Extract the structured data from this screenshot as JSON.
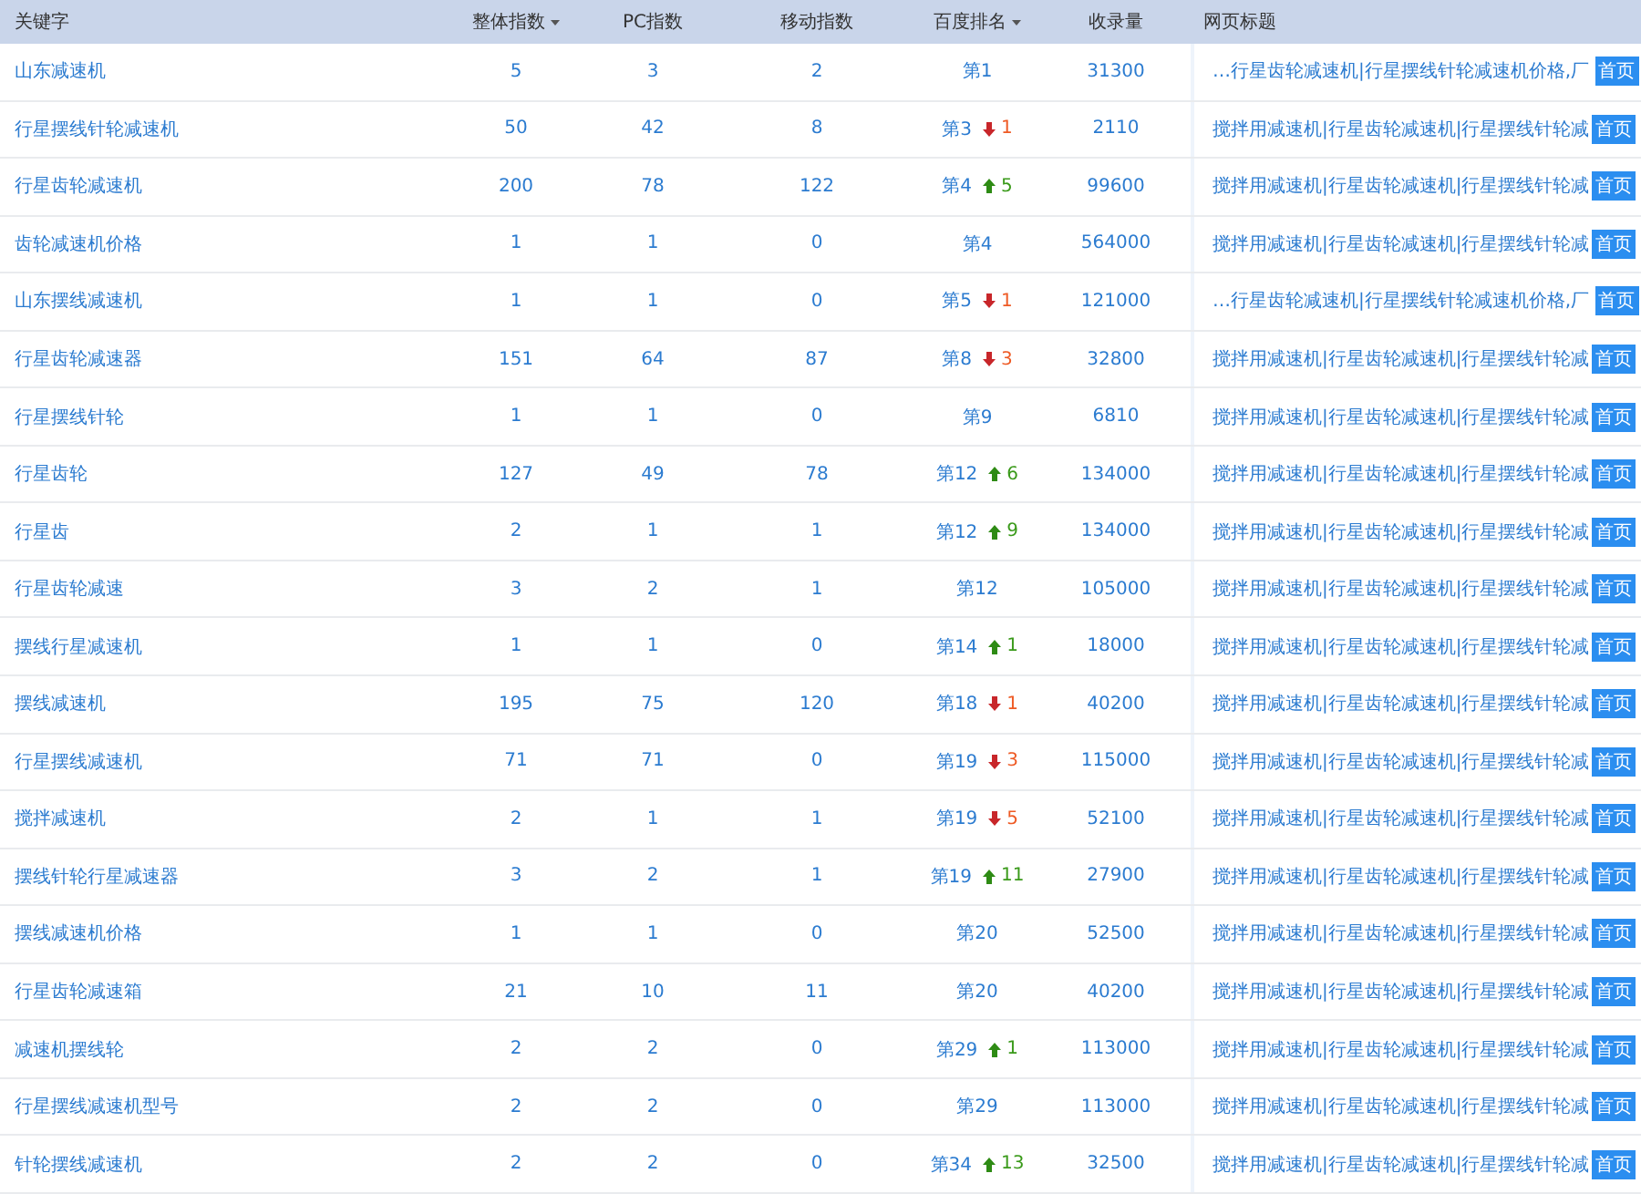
{
  "table": {
    "columns": [
      {
        "label": "关键字",
        "sorted": false
      },
      {
        "label": "整体指数",
        "sorted": true
      },
      {
        "label": "PC指数",
        "sorted": false
      },
      {
        "label": "移动指数",
        "sorted": false
      },
      {
        "label": "百度排名",
        "sorted": true
      },
      {
        "label": "收录量",
        "sorted": false
      },
      {
        "label": "网页标题",
        "sorted": false
      }
    ],
    "rows": [
      {
        "keyword": "山东减速机",
        "overall": "5",
        "pc": "3",
        "mobile": "2",
        "rank": "第1",
        "indexed": "31300",
        "title": "…行星齿轮减速机|行星摆线针轮减速机价格,厂",
        "badge": "首页"
      },
      {
        "keyword": "行星摆线针轮减速机",
        "overall": "50",
        "pc": "42",
        "mobile": "8",
        "rank": "第3",
        "change": {
          "kind": "down",
          "amount": "1"
        },
        "indexed": "2110",
        "title": "搅拌用减速机|行星齿轮减速机|行星摆线针轮减",
        "badge": "首页"
      },
      {
        "keyword": "行星齿轮减速机",
        "overall": "200",
        "pc": "78",
        "mobile": "122",
        "rank": "第4",
        "change": {
          "kind": "up",
          "amount": "5"
        },
        "indexed": "99600",
        "title": "搅拌用减速机|行星齿轮减速机|行星摆线针轮减",
        "badge": "首页"
      },
      {
        "keyword": "齿轮减速机价格",
        "overall": "1",
        "pc": "1",
        "mobile": "0",
        "rank": "第4",
        "indexed": "564000",
        "title": "搅拌用减速机|行星齿轮减速机|行星摆线针轮减",
        "badge": "首页"
      },
      {
        "keyword": "山东摆线减速机",
        "overall": "1",
        "pc": "1",
        "mobile": "0",
        "rank": "第5",
        "change": {
          "kind": "down",
          "amount": "1"
        },
        "indexed": "121000",
        "title": "…行星齿轮减速机|行星摆线针轮减速机价格,厂",
        "badge": "首页"
      },
      {
        "keyword": "行星齿轮减速器",
        "overall": "151",
        "pc": "64",
        "mobile": "87",
        "rank": "第8",
        "change": {
          "kind": "down",
          "amount": "3"
        },
        "indexed": "32800",
        "title": "搅拌用减速机|行星齿轮减速机|行星摆线针轮减",
        "badge": "首页"
      },
      {
        "keyword": "行星摆线针轮",
        "overall": "1",
        "pc": "1",
        "mobile": "0",
        "rank": "第9",
        "indexed": "6810",
        "title": "搅拌用减速机|行星齿轮减速机|行星摆线针轮减",
        "badge": "首页"
      },
      {
        "keyword": "行星齿轮",
        "overall": "127",
        "pc": "49",
        "mobile": "78",
        "rank": "第12",
        "change": {
          "kind": "up",
          "amount": "6"
        },
        "indexed": "134000",
        "title": "搅拌用减速机|行星齿轮减速机|行星摆线针轮减",
        "badge": "首页"
      },
      {
        "keyword": "行星齿",
        "overall": "2",
        "pc": "1",
        "mobile": "1",
        "rank": "第12",
        "change": {
          "kind": "up",
          "amount": "9"
        },
        "indexed": "134000",
        "title": "搅拌用减速机|行星齿轮减速机|行星摆线针轮减",
        "badge": "首页"
      },
      {
        "keyword": "行星齿轮减速",
        "overall": "3",
        "pc": "2",
        "mobile": "1",
        "rank": "第12",
        "indexed": "105000",
        "title": "搅拌用减速机|行星齿轮减速机|行星摆线针轮减",
        "badge": "首页"
      },
      {
        "keyword": "摆线行星减速机",
        "overall": "1",
        "pc": "1",
        "mobile": "0",
        "rank": "第14",
        "change": {
          "kind": "up",
          "amount": "1"
        },
        "indexed": "18000",
        "title": "搅拌用减速机|行星齿轮减速机|行星摆线针轮减",
        "badge": "首页"
      },
      {
        "keyword": "摆线减速机",
        "overall": "195",
        "pc": "75",
        "mobile": "120",
        "rank": "第18",
        "change": {
          "kind": "down",
          "amount": "1"
        },
        "indexed": "40200",
        "title": "搅拌用减速机|行星齿轮减速机|行星摆线针轮减",
        "badge": "首页"
      },
      {
        "keyword": "行星摆线减速机",
        "overall": "71",
        "pc": "71",
        "mobile": "0",
        "rank": "第19",
        "change": {
          "kind": "down",
          "amount": "3"
        },
        "indexed": "115000",
        "title": "搅拌用减速机|行星齿轮减速机|行星摆线针轮减",
        "badge": "首页"
      },
      {
        "keyword": "搅拌减速机",
        "overall": "2",
        "pc": "1",
        "mobile": "1",
        "rank": "第19",
        "change": {
          "kind": "down",
          "amount": "5"
        },
        "indexed": "52100",
        "title": "搅拌用减速机|行星齿轮减速机|行星摆线针轮减",
        "badge": "首页"
      },
      {
        "keyword": "摆线针轮行星减速器",
        "overall": "3",
        "pc": "2",
        "mobile": "1",
        "rank": "第19",
        "change": {
          "kind": "up",
          "amount": "11"
        },
        "indexed": "27900",
        "title": "搅拌用减速机|行星齿轮减速机|行星摆线针轮减",
        "badge": "首页"
      },
      {
        "keyword": "摆线减速机价格",
        "overall": "1",
        "pc": "1",
        "mobile": "0",
        "rank": "第20",
        "indexed": "52500",
        "title": "搅拌用减速机|行星齿轮减速机|行星摆线针轮减",
        "badge": "首页"
      },
      {
        "keyword": "行星齿轮减速箱",
        "overall": "21",
        "pc": "10",
        "mobile": "11",
        "rank": "第20",
        "indexed": "40200",
        "title": "搅拌用减速机|行星齿轮减速机|行星摆线针轮减",
        "badge": "首页"
      },
      {
        "keyword": "减速机摆线轮",
        "overall": "2",
        "pc": "2",
        "mobile": "0",
        "rank": "第29",
        "change": {
          "kind": "up",
          "amount": "1"
        },
        "indexed": "113000",
        "title": "搅拌用减速机|行星齿轮减速机|行星摆线针轮减",
        "badge": "首页"
      },
      {
        "keyword": "行星摆线减速机型号",
        "overall": "2",
        "pc": "2",
        "mobile": "0",
        "rank": "第29",
        "indexed": "113000",
        "title": "搅拌用减速机|行星齿轮减速机|行星摆线针轮减",
        "badge": "首页"
      },
      {
        "keyword": "针轮摆线减速机",
        "overall": "2",
        "pc": "2",
        "mobile": "0",
        "rank": "第34",
        "change": {
          "kind": "up",
          "amount": "13"
        },
        "indexed": "32500",
        "title": "搅拌用减速机|行星齿轮减速机|行星摆线针轮减",
        "badge": "首页"
      }
    ]
  }
}
